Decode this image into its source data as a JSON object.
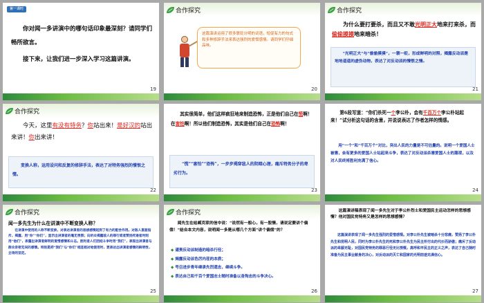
{
  "slides": [
    {
      "num": "19",
      "tag": "第一课时",
      "line1": "你对闻一多讲演中的哪句话印象最深刻？请同学们畅所欲言。",
      "line2": "接下来，让我们进一步深入学习这篇讲演。"
    },
    {
      "num": "20",
      "header": "合作探究",
      "note": "这篇演讲运用了很多褒贬分明的词语，短促有力的句式和多种修辞手法来表达强烈的爱憎感情。请同学们仔细品味。"
    },
    {
      "num": "21",
      "header": "合作探究",
      "q_a": "为什么要打要杀，而且又不敢",
      "q_red1": "光明正大",
      "q_b": "地来打来杀，而",
      "q_red2": "偷偷摸摸",
      "q_c": "地来暗杀！",
      "answer": "“光明正大”与“偷偷摸摸”，一褒一贬，形成鲜明的对照，揭露反动派是地地道道的虚伪动物，表达了对反动派的憎恨之情。"
    },
    {
      "num": "22",
      "header": "合作探究",
      "t_a": "今天，这里",
      "t_r1": "有没有特务",
      "t_b": "？",
      "t_r2": "你",
      "t_c": "站出来！",
      "t_r3": "是好汉的",
      "t_d": "站出来讲！",
      "t_r4": "你",
      "t_e": "出来讲！",
      "answer": "变换人称，运用设问和反复的修辞手法，表达了对特务强烈的憎恨之情。"
    },
    {
      "num": "23",
      "t_a": "其实很简单，他们这样疯狂地来制造恐怖，正是他们自己在",
      "t_r1": "慌",
      "t_b": "啊！在",
      "t_r2": "害怕",
      "t_c": "啊！所以他们制造恐怖，其实是他们自己在",
      "t_r3": "恐怖",
      "t_d": "啊！",
      "answer": "“慌”“害怕”“恐怖”，一步步揭穿敌人的阴暗心理，痛斥特务分子的卑劣行为。"
    },
    {
      "num": "24",
      "t_a": "第6段写道：“你们杀死一",
      "t_r1": "个",
      "t_b": "李公朴，会有",
      "t_r2": "千百万个",
      "t_c": "李公朴站起来！”试分析这句话的含意，并说说表达了作者怎样的情感。",
      "answer": "用“一个”和“千百万个”对比，突出人民的力量是不可估量的。说明一个爱国人士被害，会有更多的爱国人士站起来斗争，表达了对反动派杀害爱国人士的蔑视，以及对人民终将胜利充满了信心。"
    },
    {
      "num": "25",
      "header": "合作探究",
      "q": "闻一多先生为什么在讲演中不断变换人称？",
      "answer": "在讲演中使用的人称不断变换，对表达讲演者的思想感情起到了有力的配合作用。对敌人直面指斥，揭露，用“你”“你们”，显示出讲演者的毫无畏惧；向听众揭露敌人的罪行或者赞扬死难者时则用“他们”，表露出讲演者鲜明的爱憎感情和斗志。胜利者人们团结斗争时用“我们”，表现出讲演者与群众亲密无间的感情。特别是把“我们”与“你们”相连相对地使用时，更表达出讲演者感情的鲜明性，立场的坚定。"
    },
    {
      "num": "26",
      "header": "合作探究",
      "q": "闻先生在给臧克家的信中说：“说然有一般心，有一股情，请说定要讲个偏偿！”结合本文内容，说明闻一多是从哪几个方面“讲个偏偿”的？",
      "bullets": [
        "谴责反动派制造的暗杀行径；",
        "揭露反动派色厉内荏的本质；",
        "号召进步青年继承先烈遗志，继续斗争。",
        "表达自己和千百个爱国志士随时准备以身殉志的斗争决心。"
      ]
    },
    {
      "num": "27",
      "q": "这篇演讲稿表现了闻一多先生对于李公朴烈士和爱国民主运动怎样的思想感情？他对国民党特务又是怎样的思想感情？",
      "answer": "这篇演讲表现了闻一多先生强烈的爱憎感情。对李公朴先生被暗杀十分悲痛，赞扬了李公朴先生和昆明人民，同时为李公朴先生的死和李公朴先生为民主所付出的代价而骄傲；痛斥了反动派的卑鄙无耻，对国民党特务的罪恶行径无比愤慨，高呼和平民主的正义之声，表达了自己随时准备为民主事业献身的决心，对反动派的灭亡和国家的光明前途充满信心。"
    }
  ]
}
